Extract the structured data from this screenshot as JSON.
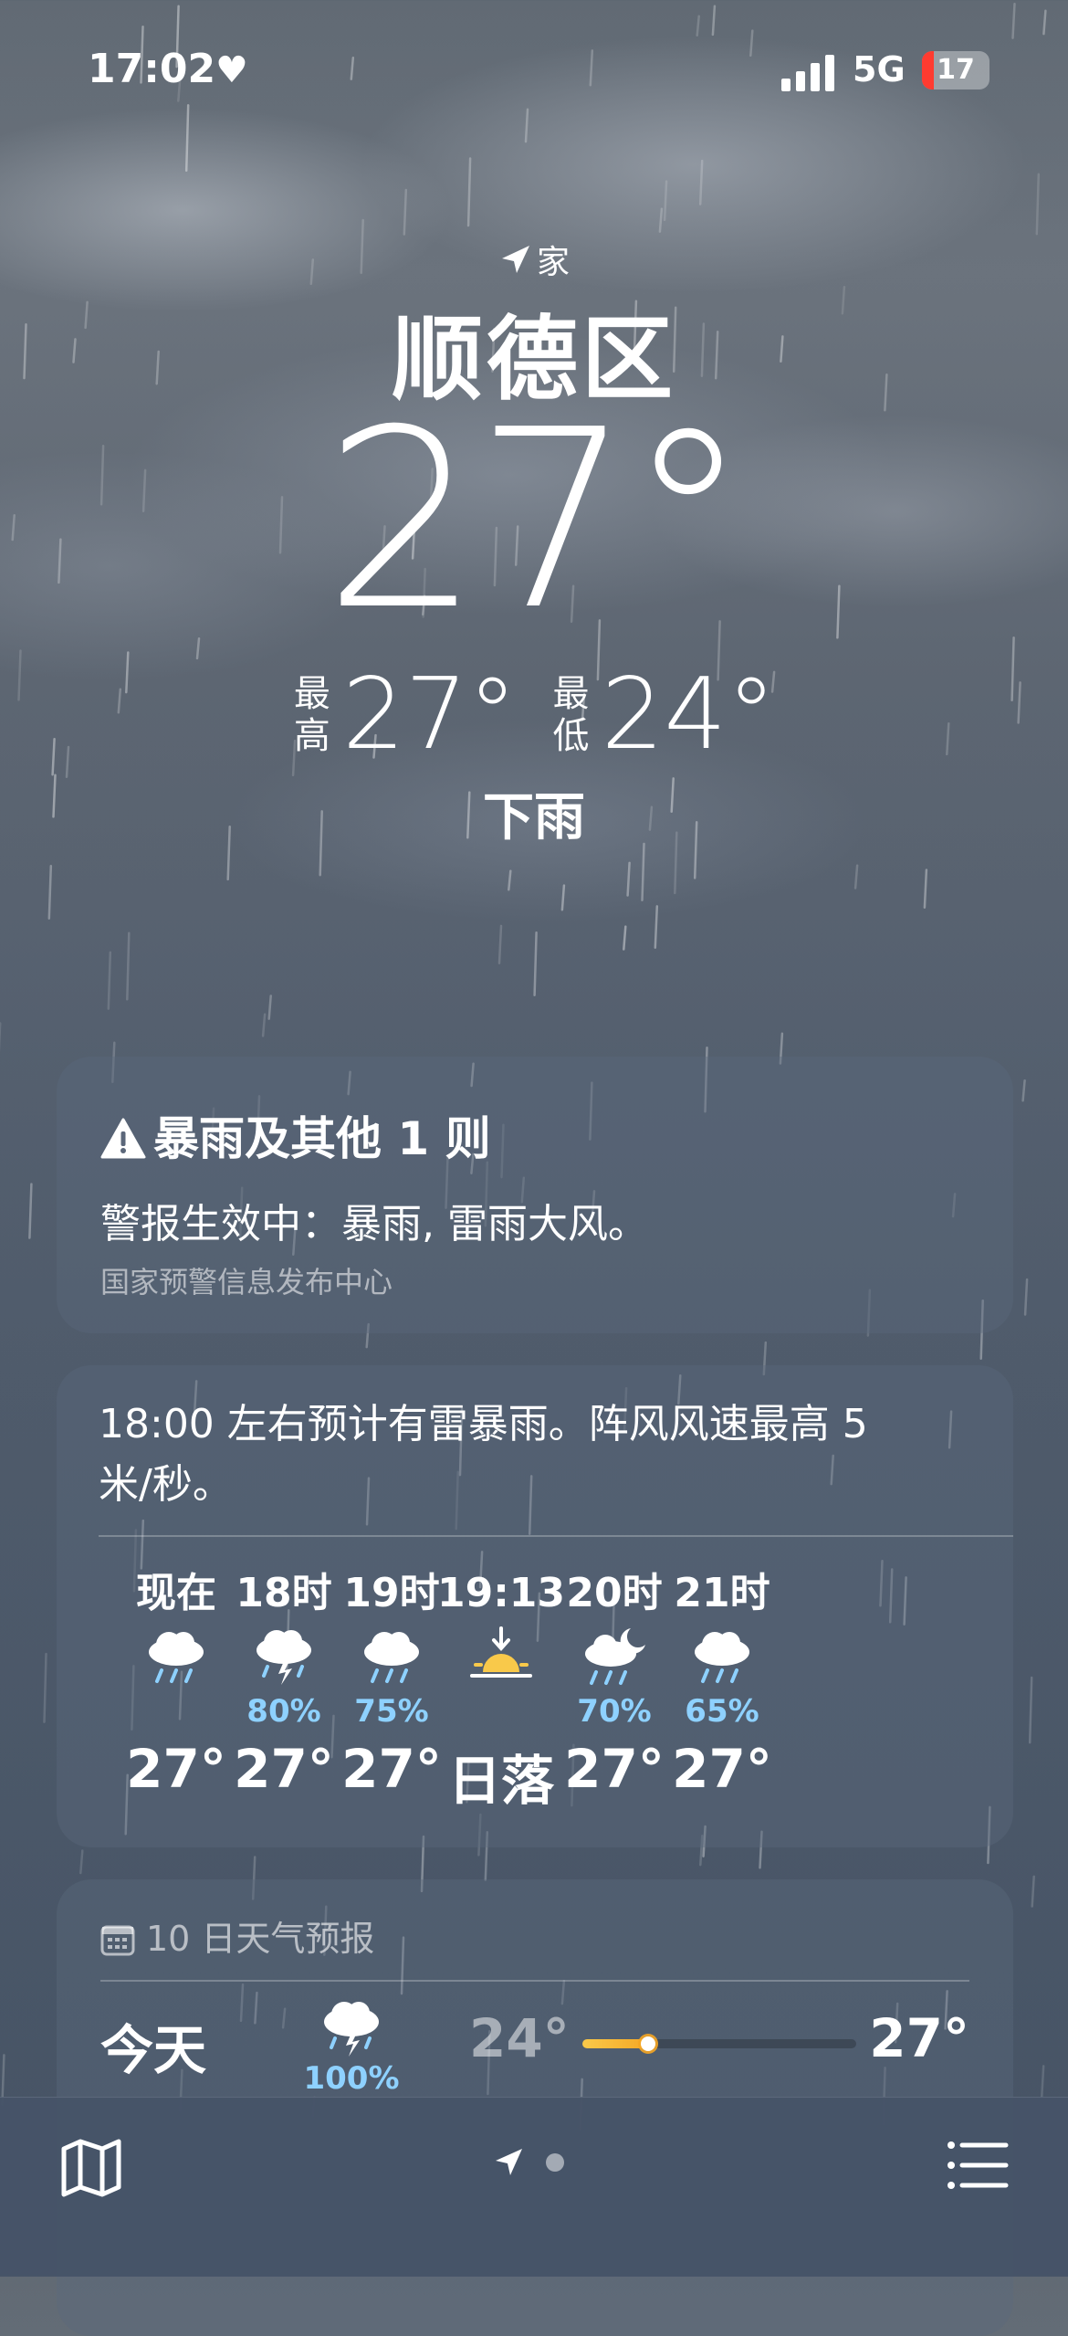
{
  "status_bar": {
    "time": "17:02",
    "network": "5G",
    "battery_level": "17",
    "battery_color": "#ff3b30"
  },
  "location": {
    "tag": "家",
    "city": "顺德区",
    "temperature": "27°",
    "high_label": "最高",
    "high": "27°",
    "low_label": "最低",
    "low": "24°",
    "condition": "下雨"
  },
  "alert": {
    "icon": "warning-triangle-icon",
    "title": "暴雨及其他 1 则",
    "body": "警报生效中：暴雨, 雷雨大风。",
    "source": "国家预警信息发布中心"
  },
  "hourly": {
    "summary": "18:00 左右预计有雷暴雨。阵风风速最高 5 米/秒。",
    "items": [
      {
        "label": "现在",
        "icon": "rain-icon",
        "pct": "",
        "value": "27°"
      },
      {
        "label": "18时",
        "icon": "thunderstorm-icon",
        "pct": "80%",
        "value": "27°"
      },
      {
        "label": "19时",
        "icon": "rain-icon",
        "pct": "75%",
        "value": "27°"
      },
      {
        "label": "19:13",
        "icon": "sunset-icon",
        "pct": "",
        "value": "日落"
      },
      {
        "label": "20时",
        "icon": "night-rain-icon",
        "pct": "70%",
        "value": "27°"
      },
      {
        "label": "21时",
        "icon": "rain-icon",
        "pct": "65%",
        "value": "27°"
      }
    ]
  },
  "daily": {
    "header": "10 日天气预报",
    "days": [
      {
        "name": "今天",
        "icon": "thunderstorm-icon",
        "pct": "100%",
        "low": "24°",
        "high": "27°"
      }
    ]
  },
  "tabbar": {
    "map_icon": "map-icon",
    "location_icon": "location-arrow-icon",
    "list_icon": "list-icon"
  },
  "colors": {
    "precip_text": "#8ed1ff",
    "range_gradient_start": "#f9c94a",
    "range_gradient_end": "#f5a623"
  }
}
